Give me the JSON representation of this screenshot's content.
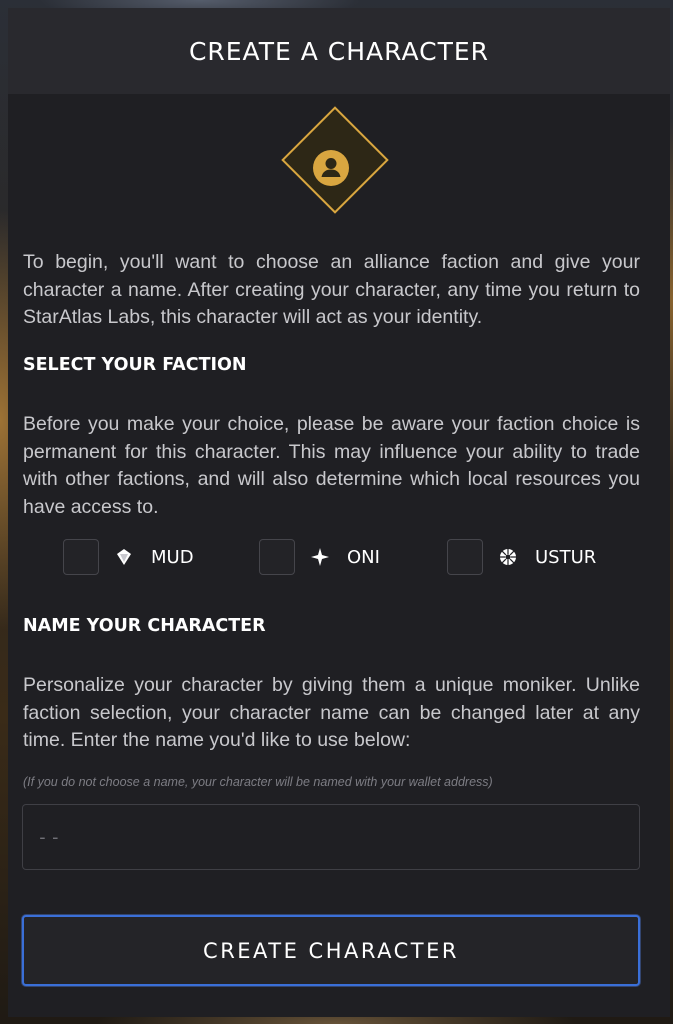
{
  "modal": {
    "title": "CREATE A CHARACTER",
    "emblem_icon": "user-circle-icon",
    "intro_text": "To begin, you'll want to choose an alliance faction and give your character a name. After creating your character, any time you return to StarAtlas Labs, this character will act as your identity."
  },
  "faction_section": {
    "heading": "SELECT YOUR FACTION",
    "description": "Before you make your choice, please be aware your faction choice is permanent for this character. This may influence your ability to trade with other factions, and will also determine which local resources you have access to.",
    "options": [
      {
        "label": "MUD",
        "icon": "mud-faction-icon",
        "checked": false
      },
      {
        "label": "ONI",
        "icon": "oni-faction-icon",
        "checked": false
      },
      {
        "label": "USTUR",
        "icon": "ustur-faction-icon",
        "checked": false
      }
    ]
  },
  "name_section": {
    "heading": "NAME YOUR CHARACTER",
    "description": "Personalize your character by giving them a unique moniker. Unlike faction selection, your character name can be changed later at any time. Enter the name you'd like to use below:",
    "hint": "(If you do not choose a name, your character will be named with your wallet address)",
    "input_value": "",
    "input_placeholder": "--"
  },
  "actions": {
    "create_label": "CREATE CHARACTER"
  },
  "colors": {
    "accent_gold": "#d9a640",
    "button_border_blue": "#3a6fd8",
    "panel_bg": "#1f1f23",
    "header_bg": "#29292e"
  }
}
